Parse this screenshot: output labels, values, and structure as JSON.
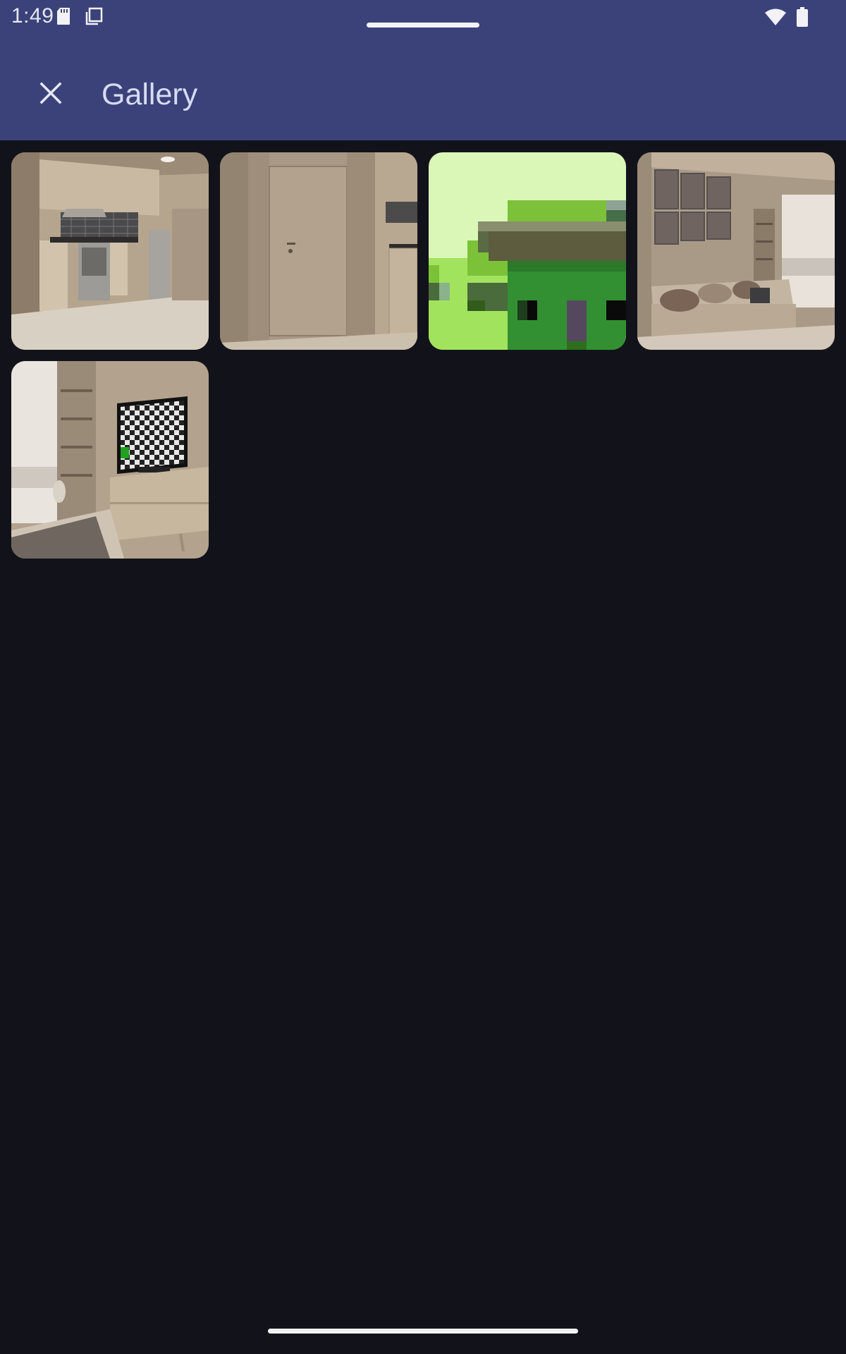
{
  "status_bar": {
    "time": "1:49",
    "icons": [
      "sd-card-icon",
      "screen-copy-icon",
      "wifi-icon",
      "battery-icon"
    ]
  },
  "app_bar": {
    "title": "Gallery",
    "close_icon": "close-icon",
    "background": "#3b4279"
  },
  "gallery": {
    "items": [
      {
        "name": "kitchen-photo"
      },
      {
        "name": "door-hallway-photo"
      },
      {
        "name": "pixel-art-image"
      },
      {
        "name": "living-room-sofa-photo"
      },
      {
        "name": "tv-room-photo"
      }
    ]
  },
  "colors": {
    "background": "#12131a",
    "title_text": "#d7dbf3"
  }
}
